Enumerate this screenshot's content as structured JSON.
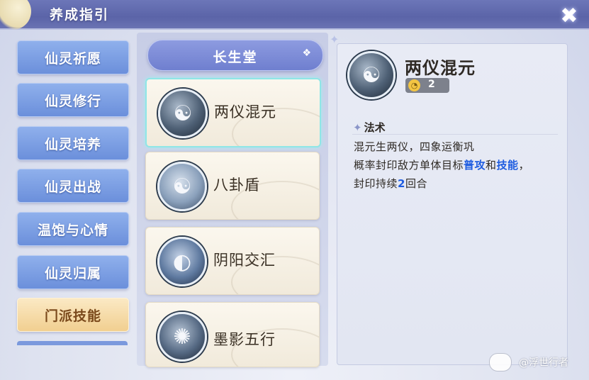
{
  "header": {
    "title": "养成指引"
  },
  "nav": {
    "items": [
      {
        "label": "仙灵祈愿",
        "active": false
      },
      {
        "label": "仙灵修行",
        "active": false
      },
      {
        "label": "仙灵培养",
        "active": false
      },
      {
        "label": "仙灵出战",
        "active": false
      },
      {
        "label": "温饱与心情",
        "active": false
      },
      {
        "label": "仙灵归属",
        "active": false
      },
      {
        "label": "门派技能",
        "active": true
      }
    ]
  },
  "school": {
    "selected": "长生堂"
  },
  "skills": [
    {
      "name": "两仪混元",
      "icon": "yin-yang-orb-icon",
      "selected": true
    },
    {
      "name": "八卦盾",
      "icon": "bagua-shield-icon",
      "selected": false
    },
    {
      "name": "阴阳交汇",
      "icon": "yin-yang-converge-icon",
      "selected": false
    },
    {
      "name": "墨影五行",
      "icon": "ink-shadow-icon",
      "selected": false
    }
  ],
  "detail": {
    "name": "两仪混元",
    "cooldown": "2",
    "section_title": "法术",
    "desc_line1": "混元生两仪，四象运衡巩",
    "desc_line2_a": "概率封印敌方单体目标",
    "desc_line2_hl1": "普攻",
    "desc_line2_b": "和",
    "desc_line2_hl2": "技能",
    "desc_line2_c": "，",
    "desc_line3_a": "封印持续",
    "desc_line3_num": "2",
    "desc_line3_b": "回合"
  },
  "watermark": {
    "text": "@浮世行者"
  },
  "colors": {
    "nav_blue": "#7b99dd",
    "nav_active": "#f1cf90",
    "highlight_text": "#1e5ce0",
    "header": "#5b64a8",
    "selected_border": "#8fe6e6"
  }
}
